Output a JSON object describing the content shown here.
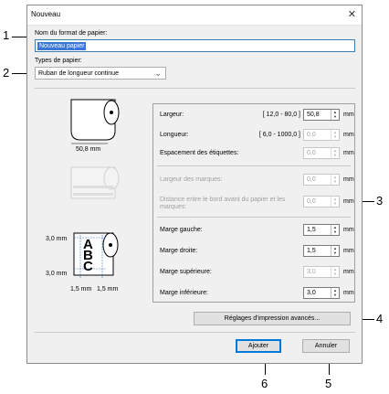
{
  "callouts": [
    "1",
    "2",
    "3",
    "4",
    "5",
    "6"
  ],
  "dialog": {
    "title": "Nouveau",
    "close_glyph": "✕"
  },
  "paper_name": {
    "label": "Nom du format de papier:",
    "value": "Nouveau papier"
  },
  "paper_type": {
    "label": "Types de papier:",
    "value": "Ruban de longueur continue"
  },
  "illustrations": {
    "width_caption": "50,8 mm",
    "margin_top": "3,0 mm",
    "margin_bottom": "3,0 mm",
    "margin_left": "1,5 mm",
    "margin_right": "1,5 mm",
    "letters": [
      "A",
      "B",
      "C"
    ]
  },
  "fields": [
    {
      "label": "Largeur:",
      "range": "[ 12,0 - 80,0 ]",
      "value": "50,8",
      "unit": "mm",
      "enabled": true
    },
    {
      "label": "Longueur:",
      "range": "[ 6,0 - 1000,0 ]",
      "value": "0,0",
      "unit": "mm",
      "enabled": false
    },
    {
      "label": "Espacement des étiquettes:",
      "range": "",
      "value": "0,0",
      "unit": "mm",
      "enabled": false
    },
    {
      "label": "Largeur des marques:",
      "range": "",
      "value": "0,0",
      "unit": "mm",
      "enabled": false
    },
    {
      "label": "Distance entre le bord avant du papier et les marques:",
      "range": "",
      "value": "0,0",
      "unit": "mm",
      "enabled": false
    },
    {
      "label": "Marge gauche:",
      "range": "",
      "value": "1,5",
      "unit": "mm",
      "enabled": true
    },
    {
      "label": "Marge droite:",
      "range": "",
      "value": "1,5",
      "unit": "mm",
      "enabled": true
    },
    {
      "label": "Marge supérieure:",
      "range": "",
      "value": "3,0",
      "unit": "mm",
      "enabled": false
    },
    {
      "label": "Marge inférieure:",
      "range": "",
      "value": "3,0",
      "unit": "mm",
      "enabled": true
    }
  ],
  "buttons": {
    "advanced": "Réglages d'impression avancés...",
    "add": "Ajouter",
    "cancel": "Annuler"
  }
}
